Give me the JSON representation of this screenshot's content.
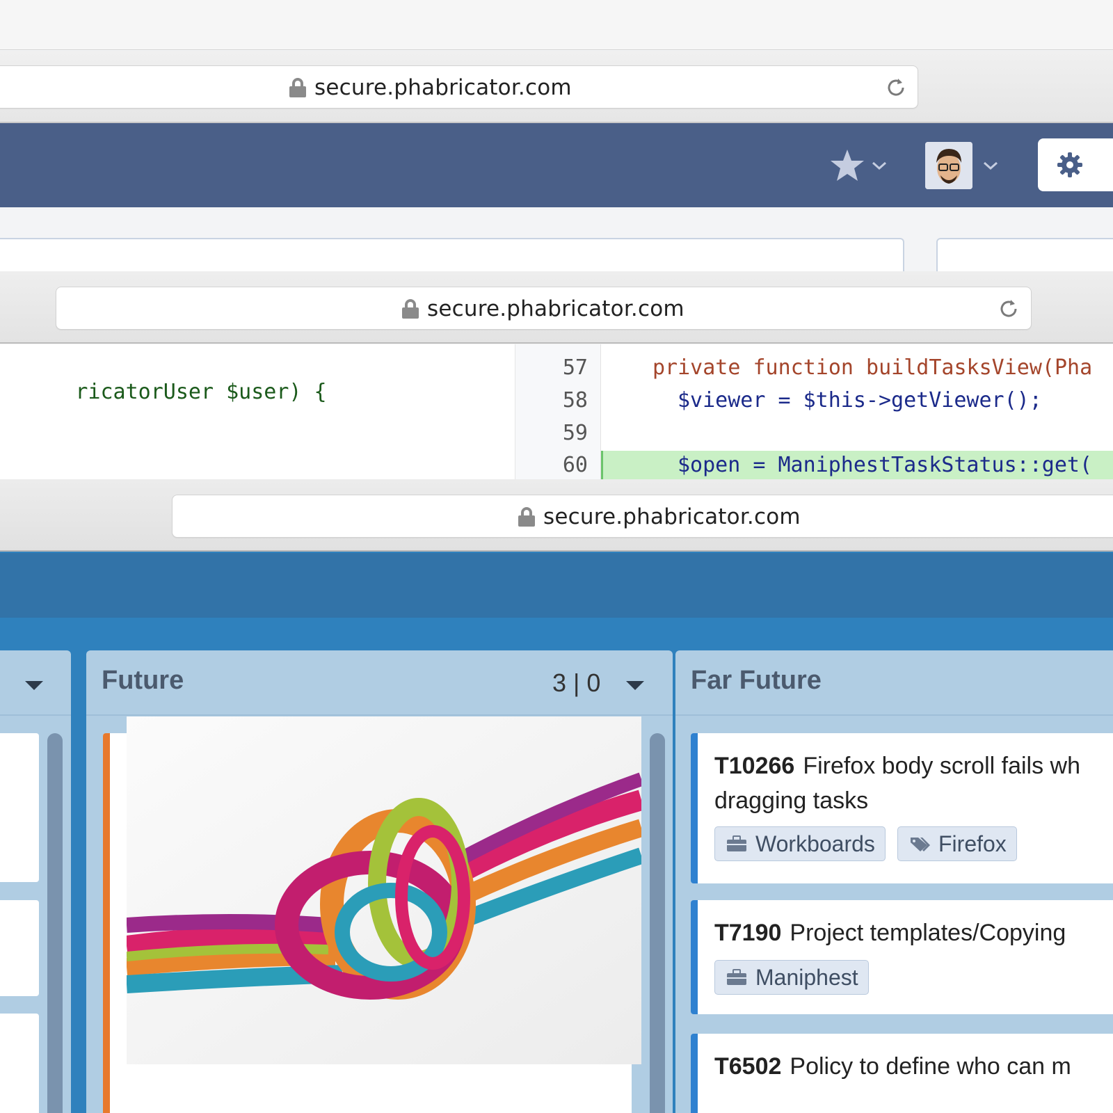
{
  "browser": {
    "url_1": "secure.phabricator.com",
    "url_2": "secure.phabricator.com",
    "url_3": "secure.phabricator.com"
  },
  "header": {
    "favorites_icon": "star-icon",
    "user_menu_icon": "avatar",
    "settings_icon": "gear-icon"
  },
  "code": {
    "lines": [
      {
        "number": "57",
        "text": "private function buildTasksView(Pha"
      },
      {
        "number": "58",
        "text": "$viewer = $this->getViewer();"
      },
      {
        "number": "59",
        "text": ""
      },
      {
        "number": "60",
        "text": "$open = ManiphestTaskStatus::get("
      }
    ],
    "left_fragment": "ricatorUser $user) {"
  },
  "board": {
    "columns": [
      {
        "title": "",
        "cards": []
      },
      {
        "title": "Future",
        "count": "3 | 0",
        "cover_image": "colorful rope knot"
      },
      {
        "title": "Far Future",
        "cards": [
          {
            "id": "T10266",
            "title_line1": "Firefox body scroll fails wh",
            "title_line2": "dragging tasks",
            "tags": [
              "Workboards",
              "Firefox"
            ]
          },
          {
            "id": "T7190",
            "title_line1": "Project templates/Copying",
            "tags": [
              "Maniphest"
            ]
          },
          {
            "id": "T6502",
            "title_line1": "Policy to define who can m"
          }
        ]
      }
    ]
  },
  "colors": {
    "phab_header": "#4a5f88",
    "board_bg": "#2f81bd",
    "column_bg": "#b0cde3",
    "card_bar_orange": "#e8792c",
    "card_bar_blue": "#2f81d0",
    "diff_added": "#c9f0c5"
  }
}
